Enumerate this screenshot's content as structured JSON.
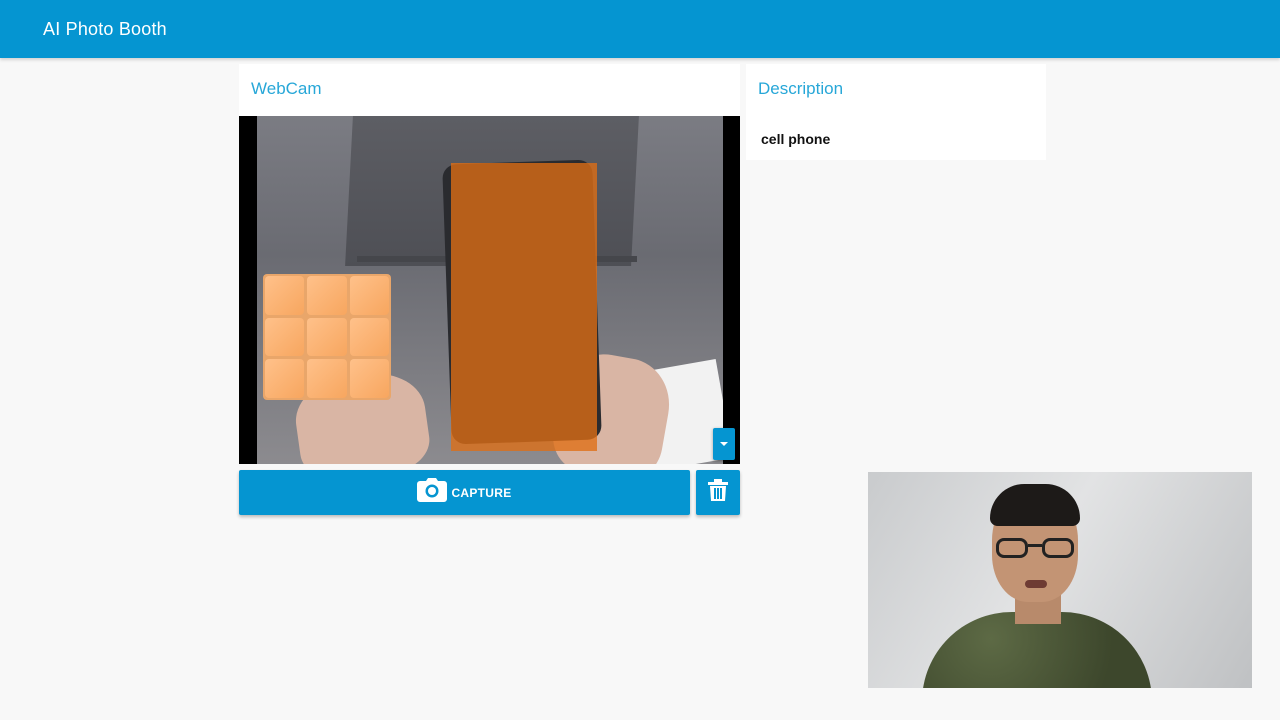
{
  "app_bar": {
    "title": "AI Photo Booth",
    "color": "#0595d1"
  },
  "webcam": {
    "title": "WebCam",
    "detection": {
      "label_color": "#df6e14"
    },
    "toggle_icon": "caret-down-icon"
  },
  "actions": {
    "capture_label": "CAPTURE",
    "capture_icon": "camera-icon",
    "delete_icon": "trash-icon"
  },
  "description": {
    "title": "Description",
    "value": "cell phone"
  },
  "colors": {
    "accent": "#0595d1",
    "heading": "#27a7d8",
    "background": "#f8f8f8"
  }
}
